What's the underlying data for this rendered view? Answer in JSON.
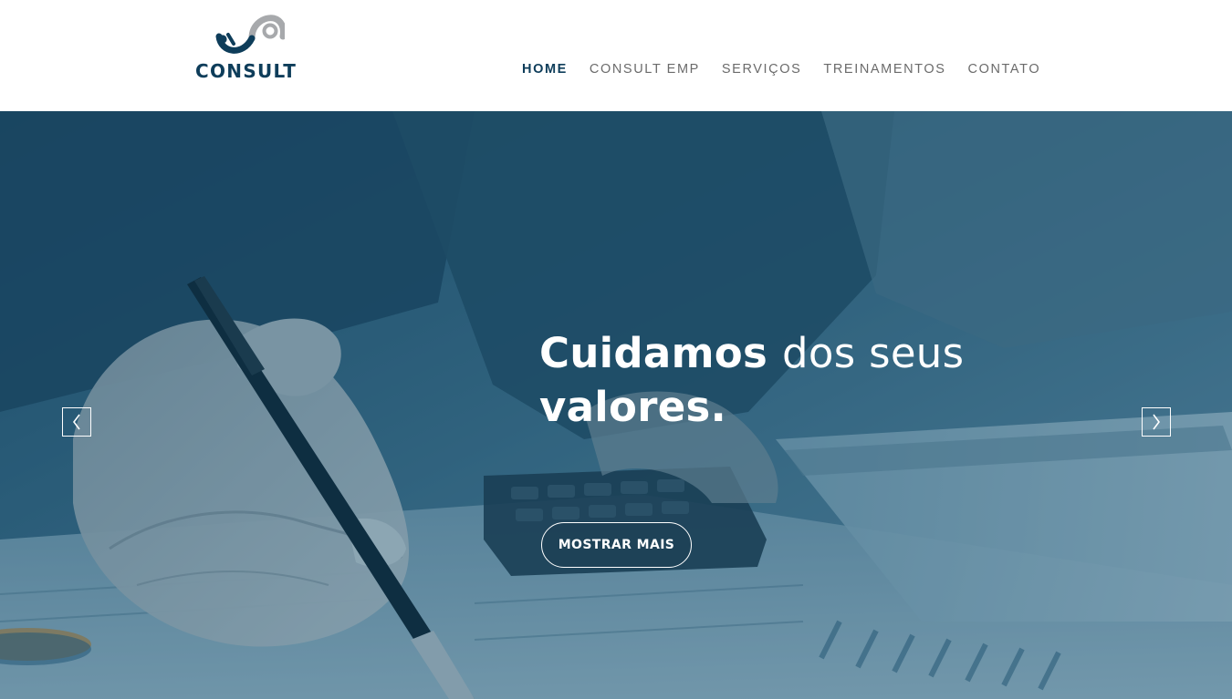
{
  "brand": {
    "name": "CONSULT",
    "logo_icon": "consult-logo-mark",
    "color": "#0e3d5a",
    "accent_gray": "#a7a9ac"
  },
  "nav": {
    "items": [
      {
        "label": "HOME",
        "active": true
      },
      {
        "label": "CONSULT EMP",
        "active": false
      },
      {
        "label": "SERVIÇOS",
        "active": false
      },
      {
        "label": "TREINAMENTOS",
        "active": false
      },
      {
        "label": "CONTATO",
        "active": false
      }
    ]
  },
  "hero": {
    "headline_bold_1": "Cuidamos",
    "headline_light": "dos seus",
    "headline_bold_2": "valores.",
    "cta_label": "MOSTRAR MAIS",
    "prev_icon": "chevron-left-icon",
    "next_icon": "chevron-right-icon",
    "overlay_color": "#164e6e"
  }
}
